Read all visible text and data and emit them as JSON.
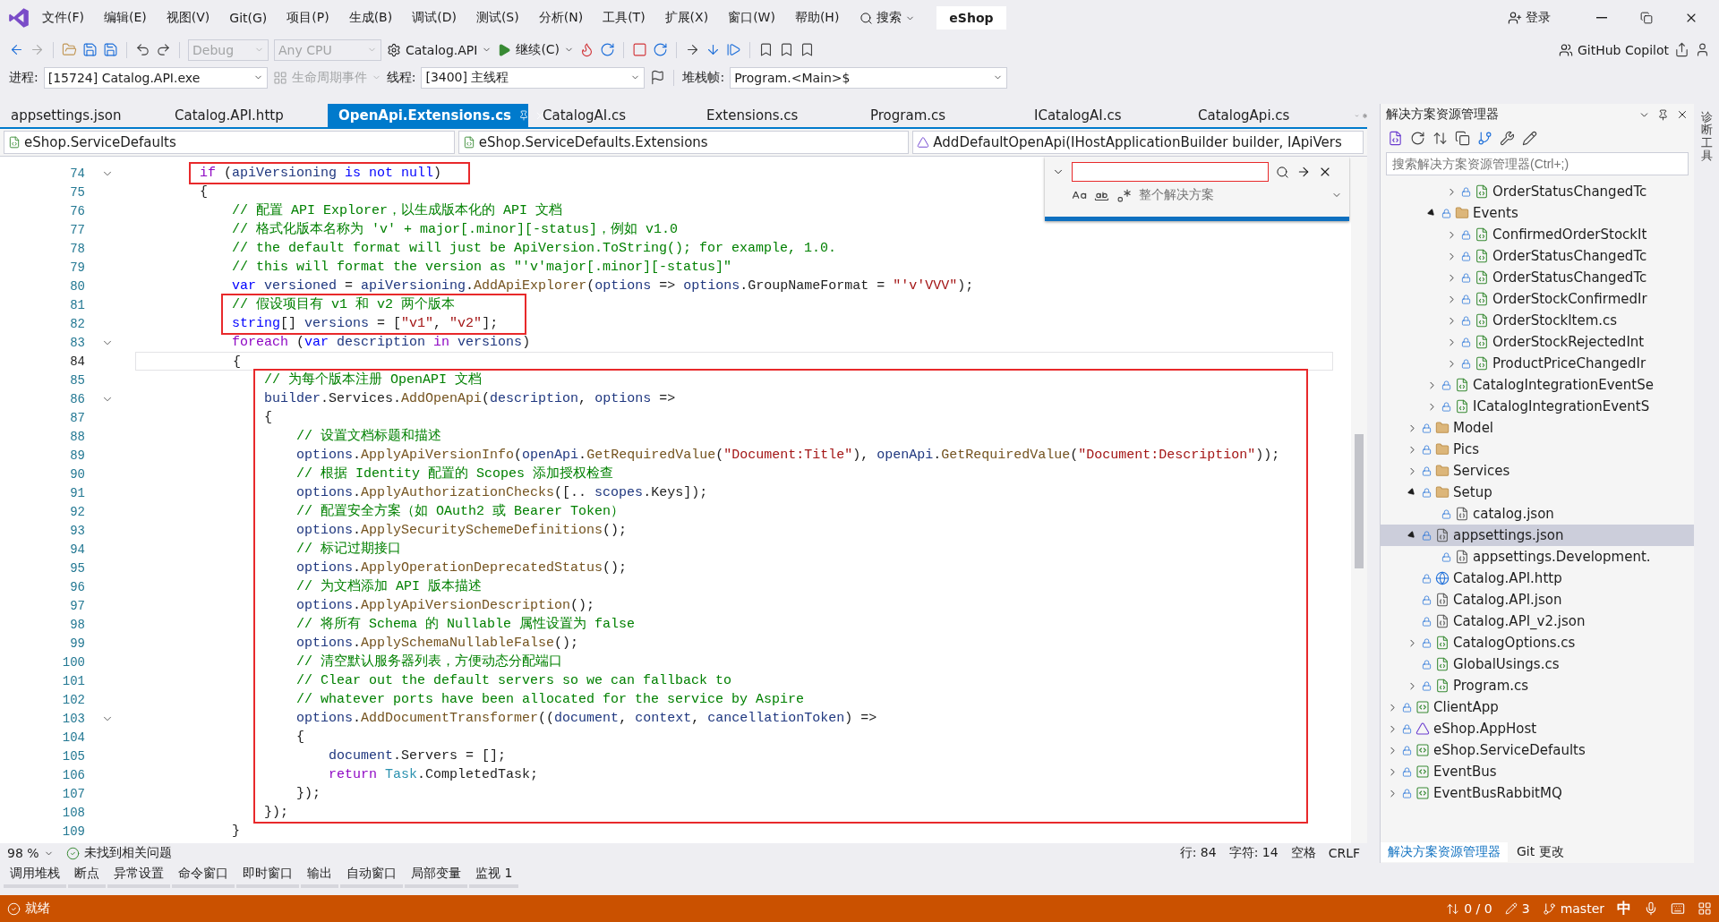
{
  "window": {
    "menu": [
      "文件(F)",
      "编辑(E)",
      "视图(V)",
      "Git(G)",
      "项目(P)",
      "生成(B)",
      "调试(D)",
      "测试(S)",
      "分析(N)",
      "工具(T)",
      "扩展(X)",
      "窗口(W)",
      "帮助(H)"
    ],
    "search": "搜索",
    "solution_name": "eShop",
    "login": "登录"
  },
  "toolbar": {
    "combos": [
      {
        "text": "Debug",
        "disabled": true
      },
      {
        "text": "Any CPU",
        "disabled": true
      }
    ],
    "startup": "Catalog.API",
    "continue": "继续(C)",
    "copilot": "GitHub Copilot"
  },
  "debug_bar": {
    "process_label": "进程:",
    "process": "[15724] Catalog.API.exe",
    "lifecycle": "生命周期事件",
    "thread_label": "线程:",
    "thread": "[3400] 主线程",
    "stack_label": "堆栈帧:",
    "stack": "Program.<Main>$"
  },
  "tabs": [
    {
      "label": "appsettings.json",
      "selected": false
    },
    {
      "label": "Catalog.API.http",
      "selected": false
    },
    {
      "label": "OpenApi.Extensions.cs",
      "selected": true
    },
    {
      "label": "CatalogAI.cs",
      "selected": false
    },
    {
      "label": "Extensions.cs",
      "selected": false
    },
    {
      "label": "Program.cs",
      "selected": false
    },
    {
      "label": "ICatalogAI.cs",
      "selected": false
    },
    {
      "label": "CatalogApi.cs",
      "selected": false
    }
  ],
  "nav_bar": [
    "eShop.ServiceDefaults",
    "eShop.ServiceDefaults.Extensions",
    "AddDefaultOpenApi(IHostApplicationBuilder builder, IApiVers"
  ],
  "find_widget": {
    "scope": "整个解决方案"
  },
  "code": [
    {
      "boxed": true,
      "lines": [
        {
          "n": "74",
          "fold": true,
          "tokens": [
            {
              "kind": "ctl",
              "text": "if"
            },
            {
              "kind": "plain",
              "text": " ("
            },
            {
              "kind": "var",
              "text": "apiVersioning"
            },
            {
              "kind": "kw",
              "text": " is not null"
            },
            {
              "kind": "plain",
              "text": ")"
            }
          ]
        }
      ]
    },
    {
      "boxed": false,
      "lines": [
        {
          "n": "75",
          "fold": false,
          "tokens": [
            {
              "kind": "plain",
              "text": "{"
            }
          ]
        },
        {
          "n": "76",
          "fold": false,
          "tokens": [
            {
              "kind": "cmt",
              "text": "// 配置 API Explorer，以生成版本化的 API 文档"
            }
          ]
        },
        {
          "n": "77",
          "fold": false,
          "tokens": [
            {
              "kind": "cmt",
              "text": "// 格式化版本名称为 'v' + major[.minor][-status]，例如 v1.0"
            }
          ]
        },
        {
          "n": "78",
          "fold": false,
          "tokens": [
            {
              "kind": "cmt",
              "text": "// the default format will just be ApiVersion.ToString(); for example, 1.0."
            }
          ]
        },
        {
          "n": "79",
          "fold": false,
          "tokens": [
            {
              "kind": "cmt",
              "text": "// this will format the version as \"'v'major[.minor][-status]\""
            }
          ]
        },
        {
          "n": "80",
          "fold": false,
          "tokens": [
            {
              "kind": "kw",
              "text": "var "
            },
            {
              "kind": "var",
              "text": "versioned"
            },
            {
              "kind": "plain",
              "text": " = "
            },
            {
              "kind": "var",
              "text": "apiVersioning"
            },
            {
              "kind": "plain",
              "text": "."
            },
            {
              "kind": "method",
              "text": "AddApiExplorer"
            },
            {
              "kind": "plain",
              "text": "("
            },
            {
              "kind": "var",
              "text": "options"
            },
            {
              "kind": "plain",
              "text": " => "
            },
            {
              "kind": "var",
              "text": "options"
            },
            {
              "kind": "plain",
              "text": ".GroupNameFormat = "
            },
            {
              "kind": "str",
              "text": "\"'v'VVV\""
            },
            {
              "kind": "plain",
              "text": ");"
            }
          ]
        }
      ]
    },
    {
      "boxed": true,
      "lines": [
        {
          "n": "81",
          "fold": false,
          "tokens": [
            {
              "kind": "cmt",
              "text": "// 假设项目有 v1 和 v2 两个版本"
            }
          ]
        },
        {
          "n": "82",
          "fold": false,
          "tokens": [
            {
              "kind": "kw",
              "text": "string"
            },
            {
              "kind": "plain",
              "text": "[] "
            },
            {
              "kind": "var",
              "text": "versions"
            },
            {
              "kind": "plain",
              "text": " = ["
            },
            {
              "kind": "str",
              "text": "\"v1\""
            },
            {
              "kind": "plain",
              "text": ", "
            },
            {
              "kind": "str",
              "text": "\"v2\""
            },
            {
              "kind": "plain",
              "text": "];"
            }
          ]
        }
      ]
    },
    {
      "boxed": false,
      "lines": [
        {
          "n": "83",
          "fold": true,
          "tokens": [
            {
              "kind": "ctl",
              "text": "foreach"
            },
            {
              "kind": "plain",
              "text": " ("
            },
            {
              "kind": "kw",
              "text": "var "
            },
            {
              "kind": "var",
              "text": "description"
            },
            {
              "kind": "ctl",
              "text": " in "
            },
            {
              "kind": "var",
              "text": "versions"
            },
            {
              "kind": "plain",
              "text": ")"
            }
          ]
        },
        {
          "n": "84",
          "fold": false,
          "current": true,
          "tokens": [
            {
              "kind": "plain",
              "text": "{"
            }
          ]
        }
      ]
    },
    {
      "boxed": true,
      "lines": [
        {
          "n": "85",
          "fold": false,
          "tokens": [
            {
              "kind": "cmt",
              "text": "// 为每个版本注册 OpenAPI 文档"
            }
          ]
        },
        {
          "n": "86",
          "fold": true,
          "tokens": [
            {
              "kind": "var",
              "text": "builder"
            },
            {
              "kind": "plain",
              "text": ".Services."
            },
            {
              "kind": "method",
              "text": "AddOpenApi"
            },
            {
              "kind": "plain",
              "text": "("
            },
            {
              "kind": "var",
              "text": "description"
            },
            {
              "kind": "plain",
              "text": ", "
            },
            {
              "kind": "var",
              "text": "options"
            },
            {
              "kind": "plain",
              "text": " =>"
            }
          ]
        },
        {
          "n": "87",
          "fold": false,
          "tokens": [
            {
              "kind": "plain",
              "text": "{"
            }
          ]
        },
        {
          "n": "88",
          "fold": false,
          "tokens": [
            {
              "kind": "cmt",
              "text": "// 设置文档标题和描述"
            }
          ]
        },
        {
          "n": "89",
          "fold": false,
          "tokens": [
            {
              "kind": "var",
              "text": "options"
            },
            {
              "kind": "plain",
              "text": "."
            },
            {
              "kind": "method",
              "text": "ApplyApiVersionInfo"
            },
            {
              "kind": "plain",
              "text": "("
            },
            {
              "kind": "var",
              "text": "openApi"
            },
            {
              "kind": "plain",
              "text": "."
            },
            {
              "kind": "method",
              "text": "GetRequiredValue"
            },
            {
              "kind": "plain",
              "text": "("
            },
            {
              "kind": "str",
              "text": "\"Document:Title\""
            },
            {
              "kind": "plain",
              "text": "), "
            },
            {
              "kind": "var",
              "text": "openApi"
            },
            {
              "kind": "plain",
              "text": "."
            },
            {
              "kind": "method",
              "text": "GetRequiredValue"
            },
            {
              "kind": "plain",
              "text": "("
            },
            {
              "kind": "str",
              "text": "\"Document:Description\""
            },
            {
              "kind": "plain",
              "text": "));"
            }
          ]
        },
        {
          "n": "90",
          "fold": false,
          "tokens": [
            {
              "kind": "cmt",
              "text": "// 根据 Identity 配置的 Scopes 添加授权检查"
            }
          ]
        },
        {
          "n": "91",
          "fold": false,
          "tokens": [
            {
              "kind": "var",
              "text": "options"
            },
            {
              "kind": "plain",
              "text": "."
            },
            {
              "kind": "method",
              "text": "ApplyAuthorizationChecks"
            },
            {
              "kind": "plain",
              "text": "([.. "
            },
            {
              "kind": "var",
              "text": "scopes"
            },
            {
              "kind": "plain",
              "text": ".Keys]);"
            }
          ]
        },
        {
          "n": "92",
          "fold": false,
          "tokens": [
            {
              "kind": "cmt",
              "text": "// 配置安全方案（如 OAuth2 或 Bearer Token）"
            }
          ]
        },
        {
          "n": "93",
          "fold": false,
          "tokens": [
            {
              "kind": "var",
              "text": "options"
            },
            {
              "kind": "plain",
              "text": "."
            },
            {
              "kind": "method",
              "text": "ApplySecuritySchemeDefinitions"
            },
            {
              "kind": "plain",
              "text": "();"
            }
          ]
        },
        {
          "n": "94",
          "fold": false,
          "tokens": [
            {
              "kind": "cmt",
              "text": "// 标记过期接口"
            }
          ]
        },
        {
          "n": "95",
          "fold": false,
          "tokens": [
            {
              "kind": "var",
              "text": "options"
            },
            {
              "kind": "plain",
              "text": "."
            },
            {
              "kind": "method",
              "text": "ApplyOperationDeprecatedStatus"
            },
            {
              "kind": "plain",
              "text": "();"
            }
          ]
        },
        {
          "n": "96",
          "fold": false,
          "tokens": [
            {
              "kind": "cmt",
              "text": "// 为文档添加 API 版本描述"
            }
          ]
        },
        {
          "n": "97",
          "fold": false,
          "tokens": [
            {
              "kind": "var",
              "text": "options"
            },
            {
              "kind": "plain",
              "text": "."
            },
            {
              "kind": "method",
              "text": "ApplyApiVersionDescription"
            },
            {
              "kind": "plain",
              "text": "();"
            }
          ]
        },
        {
          "n": "98",
          "fold": false,
          "tokens": [
            {
              "kind": "cmt",
              "text": "// 将所有 Schema 的 Nullable 属性设置为 false"
            }
          ]
        },
        {
          "n": "99",
          "fold": false,
          "tokens": [
            {
              "kind": "var",
              "text": "options"
            },
            {
              "kind": "plain",
              "text": "."
            },
            {
              "kind": "method",
              "text": "ApplySchemaNullableFalse"
            },
            {
              "kind": "plain",
              "text": "();"
            }
          ]
        },
        {
          "n": "100",
          "fold": false,
          "tokens": [
            {
              "kind": "cmt",
              "text": "// 清空默认服务器列表，方便动态分配端口"
            }
          ]
        },
        {
          "n": "101",
          "fold": false,
          "tokens": [
            {
              "kind": "cmt",
              "text": "// Clear out the default servers so we can fallback to"
            }
          ]
        },
        {
          "n": "102",
          "fold": false,
          "tokens": [
            {
              "kind": "cmt",
              "text": "// whatever ports have been allocated for the service by Aspire"
            }
          ]
        },
        {
          "n": "103",
          "fold": true,
          "tokens": [
            {
              "kind": "var",
              "text": "options"
            },
            {
              "kind": "plain",
              "text": "."
            },
            {
              "kind": "method",
              "text": "AddDocumentTransformer"
            },
            {
              "kind": "plain",
              "text": "(("
            },
            {
              "kind": "var",
              "text": "document"
            },
            {
              "kind": "plain",
              "text": ", "
            },
            {
              "kind": "var",
              "text": "context"
            },
            {
              "kind": "plain",
              "text": ", "
            },
            {
              "kind": "var",
              "text": "cancellationToken"
            },
            {
              "kind": "plain",
              "text": ") =>"
            }
          ]
        },
        {
          "n": "104",
          "fold": false,
          "tokens": [
            {
              "kind": "plain",
              "text": "{"
            }
          ]
        },
        {
          "n": "105",
          "fold": false,
          "tokens": [
            {
              "kind": "var",
              "text": "document"
            },
            {
              "kind": "plain",
              "text": ".Servers = [];"
            }
          ]
        },
        {
          "n": "106",
          "fold": false,
          "tokens": [
            {
              "kind": "ctl",
              "text": "return "
            },
            {
              "kind": "type",
              "text": "Task"
            },
            {
              "kind": "plain",
              "text": ".CompletedTask;"
            }
          ]
        },
        {
          "n": "107",
          "fold": false,
          "tokens": [
            {
              "kind": "plain",
              "text": "});"
            }
          ]
        },
        {
          "n": "108",
          "fold": false,
          "tokens": [
            {
              "kind": "plain",
              "text": "});"
            }
          ]
        }
      ]
    },
    {
      "boxed": false,
      "lines": [
        {
          "n": "109",
          "fold": false,
          "tokens": [
            {
              "kind": "plain",
              "text": "}"
            }
          ]
        }
      ]
    }
  ],
  "editor_status": {
    "zoom": "98 %",
    "issues": "未找到相关问题",
    "line": "行: 84",
    "char": "字符: 14",
    "indent": "空格",
    "eol": "CRLF"
  },
  "solution_explorer": {
    "title": "解决方案资源管理器",
    "placeholder": "搜索解决方案资源管理器(Ctrl+;)",
    "tree": [
      {
        "children": [
          {
            "children": [
              {
                "children": [
                  {
                    "label": "OrderStatusChangedTc",
                    "kind": "cs",
                    "expanded": false,
                    "selected": false
                  }
                ]
              },
              {
                "label": "Events",
                "kind": "folder",
                "expanded": true,
                "selected": false,
                "children": [
                  {
                    "label": "ConfirmedOrderStockIt",
                    "kind": "cs",
                    "expanded": false,
                    "selected": false
                  },
                  {
                    "label": "OrderStatusChangedTc",
                    "kind": "cs",
                    "expanded": false,
                    "selected": false
                  },
                  {
                    "label": "OrderStatusChangedTc",
                    "kind": "cs",
                    "expanded": false,
                    "selected": false
                  },
                  {
                    "label": "OrderStockConfirmedIr",
                    "kind": "cs",
                    "expanded": false,
                    "selected": false
                  },
                  {
                    "label": "OrderStockItem.cs",
                    "kind": "cs",
                    "expanded": false,
                    "selected": false
                  },
                  {
                    "label": "OrderStockRejectedInt",
                    "kind": "cs",
                    "expanded": false,
                    "selected": false
                  },
                  {
                    "label": "ProductPriceChangedIr",
                    "kind": "cs",
                    "expanded": false,
                    "selected": false
                  }
                ]
              },
              {
                "label": "CatalogIntegrationEventSe",
                "kind": "cs",
                "expanded": false,
                "selected": false
              },
              {
                "label": "ICatalogIntegrationEventS",
                "kind": "cs",
                "expanded": false,
                "selected": false
              }
            ]
          },
          {
            "label": "Model",
            "kind": "folder",
            "expanded": false,
            "selected": false
          },
          {
            "label": "Pics",
            "kind": "folder",
            "expanded": false,
            "selected": false
          },
          {
            "label": "Services",
            "kind": "folder",
            "expanded": false,
            "selected": false
          },
          {
            "label": "Setup",
            "kind": "folder",
            "expanded": true,
            "selected": false,
            "children": [
              {
                "label": "catalog.json",
                "kind": "json",
                "selected": false
              }
            ]
          },
          {
            "label": "appsettings.json",
            "kind": "json",
            "expanded": true,
            "selected": true,
            "children": [
              {
                "label": "appsettings.Development.",
                "kind": "json",
                "selected": false
              }
            ]
          },
          {
            "label": "Catalog.API.http",
            "kind": "http",
            "selected": false
          },
          {
            "label": "Catalog.API.json",
            "kind": "json",
            "selected": false
          },
          {
            "label": "Catalog.API_v2.json",
            "kind": "json",
            "selected": false
          },
          {
            "label": "CatalogOptions.cs",
            "kind": "cs",
            "expanded": false,
            "selected": false
          },
          {
            "label": "GlobalUsings.cs",
            "kind": "cs",
            "selected": false
          },
          {
            "label": "Program.cs",
            "kind": "cs",
            "expanded": false,
            "selected": false
          }
        ]
      },
      {
        "label": "ClientApp",
        "kind": "project",
        "expanded": false,
        "selected": false
      },
      {
        "label": "eShop.AppHost",
        "kind": "apphost",
        "expanded": false,
        "selected": false
      },
      {
        "label": "eShop.ServiceDefaults",
        "kind": "project",
        "expanded": false,
        "selected": false
      },
      {
        "label": "EventBus",
        "kind": "project",
        "expanded": false,
        "selected": false
      },
      {
        "label": "EventBusRabbitMQ",
        "kind": "project",
        "expanded": false,
        "selected": false
      }
    ],
    "bottom_tabs": [
      {
        "label": "解决方案资源管理器",
        "selected": true
      },
      {
        "label": "Git 更改",
        "selected": false
      }
    ]
  },
  "side_strip": "诊断工具",
  "tool_tabs": [
    "调用堆栈",
    "断点",
    "异常设置",
    "命令窗口",
    "即时窗口",
    "输出",
    "自动窗口",
    "局部变量",
    "监视 1"
  ],
  "status_bar": {
    "state": "就绪",
    "changes": "0 / 0",
    "edits": "3",
    "branch": "master",
    "ime": "中"
  }
}
